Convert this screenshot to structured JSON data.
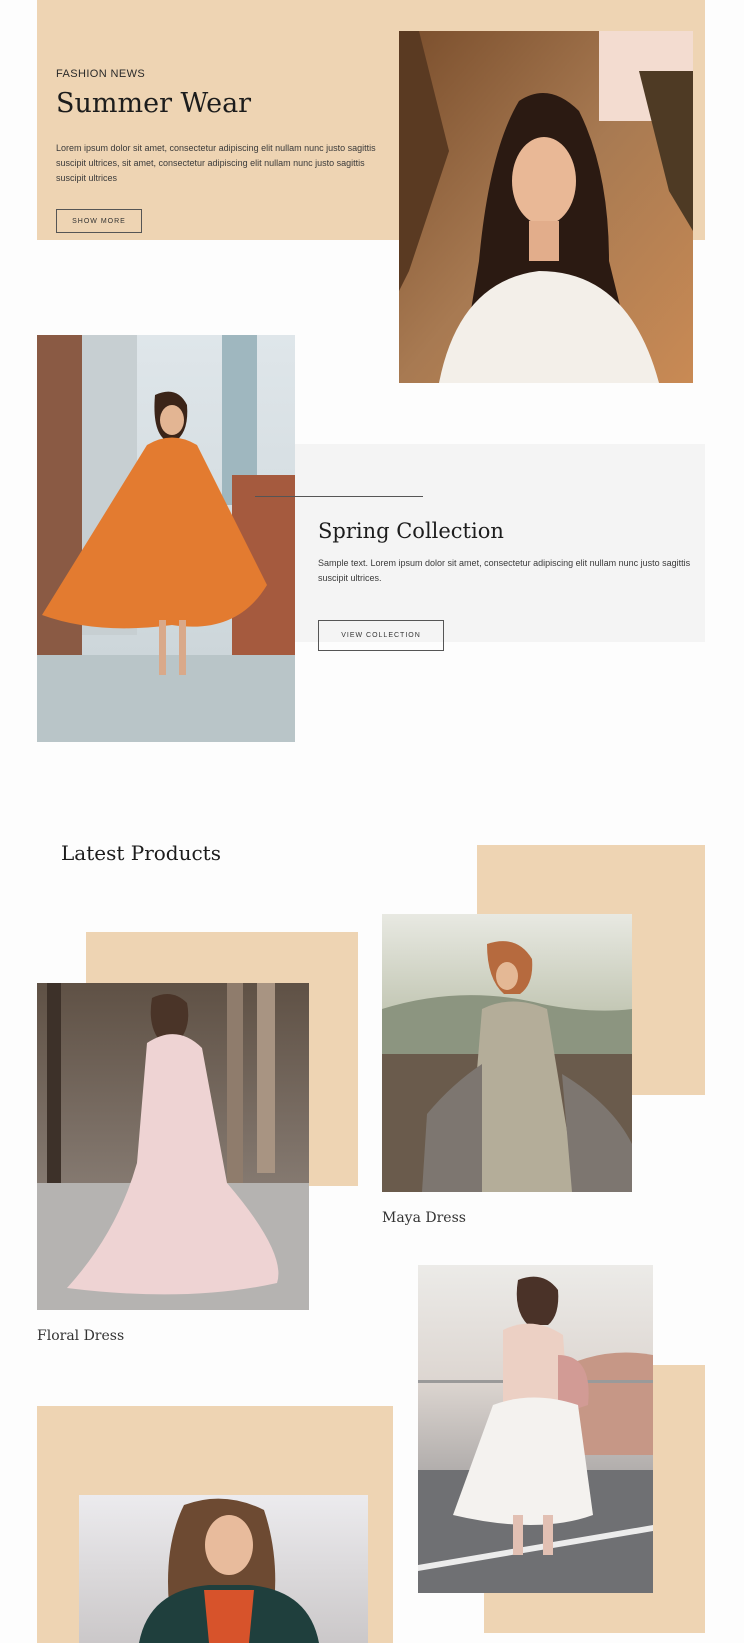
{
  "hero": {
    "eyebrow": "FASHION NEWS",
    "title": "Summer Wear",
    "body": "Lorem ipsum dolor sit amet, consectetur adipiscing elit nullam nunc justo sagittis suscipit ultrices, sit amet, consectetur adipiscing elit nullam nunc justo sagittis suscipit ultrices",
    "button_label": "SHOW MORE"
  },
  "spring": {
    "title": "Spring Collection",
    "body": "Sample text. Lorem ipsum dolor sit amet, consectetur adipiscing elit nullam nunc justo sagittis suscipit ultrices.",
    "button_label": "VIEW COLLECTION"
  },
  "products": {
    "section_title": "Latest Products",
    "items": [
      {
        "name": "Floral Dress"
      },
      {
        "name": "Maya Dress"
      }
    ]
  },
  "colors": {
    "accent_tan": "#eed4b3",
    "panel_gray": "#f4f4f4",
    "text_dark": "#1c1c1c"
  }
}
